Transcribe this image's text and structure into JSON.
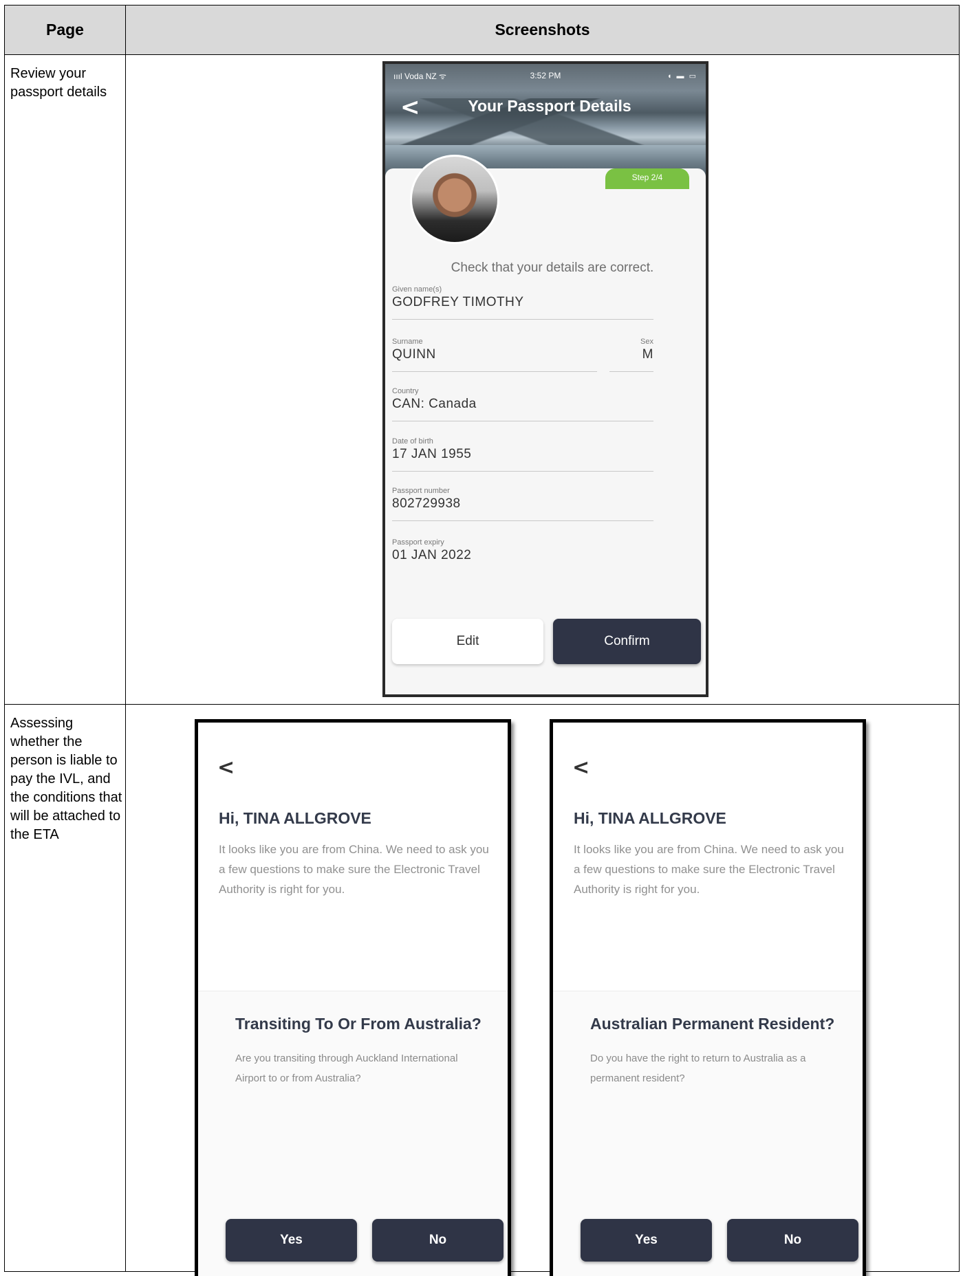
{
  "table": {
    "headers": {
      "page": "Page",
      "screenshots": "Screenshots"
    },
    "rows": [
      {
        "page": "Review your passport details"
      },
      {
        "page": "Assessing whether the person is liable to pay the IVL, and the conditions that will be attached to the ETA"
      }
    ]
  },
  "passport_screen": {
    "status_bar": {
      "carrier": "ıııl Voda NZ ᯤ",
      "time": "3:52 PM",
      "battery": "◖ ▬ ▭"
    },
    "back_icon": "chevron-left-icon",
    "title": "Your Passport Details",
    "step": "Step 2/4",
    "instruction": "Check that your details are correct.",
    "fields": {
      "given_names": {
        "label": "Given name(s)",
        "value": "GODFREY TIMOTHY"
      },
      "surname": {
        "label": "Surname",
        "value": "QUINN"
      },
      "sex": {
        "label": "Sex",
        "value": "M"
      },
      "country": {
        "label": "Country",
        "value": "CAN: Canada"
      },
      "dob": {
        "label": "Date of birth",
        "value": "17 JAN 1955"
      },
      "passport_number": {
        "label": "Passport number",
        "value": "802729938"
      },
      "passport_expiry": {
        "label": "Passport expiry",
        "value": "01 JAN 2022"
      }
    },
    "buttons": {
      "edit": "Edit",
      "confirm": "Confirm"
    },
    "colors": {
      "step_badge": "#7ac143",
      "primary_button": "#2f3446"
    }
  },
  "question_screens": [
    {
      "greeting": "Hi, TINA ALLGROVE",
      "intro": "It looks like you are from China. We need to ask you a few questions to make sure the Electronic Travel Authority is right for you.",
      "question_title": "Transiting To Or From Australia?",
      "question_text": "Are you transiting through Auckland International Airport to or from Australia?",
      "yes": "Yes",
      "no": "No"
    },
    {
      "greeting": "Hi, TINA ALLGROVE",
      "intro": "It looks like you are from China. We need to ask you a few questions to make sure the Electronic Travel Authority is right for you.",
      "question_title": "Australian Permanent Resident?",
      "question_text": "Do you have the right to return to Australia as a permanent resident?",
      "yes": "Yes",
      "no": "No"
    }
  ]
}
